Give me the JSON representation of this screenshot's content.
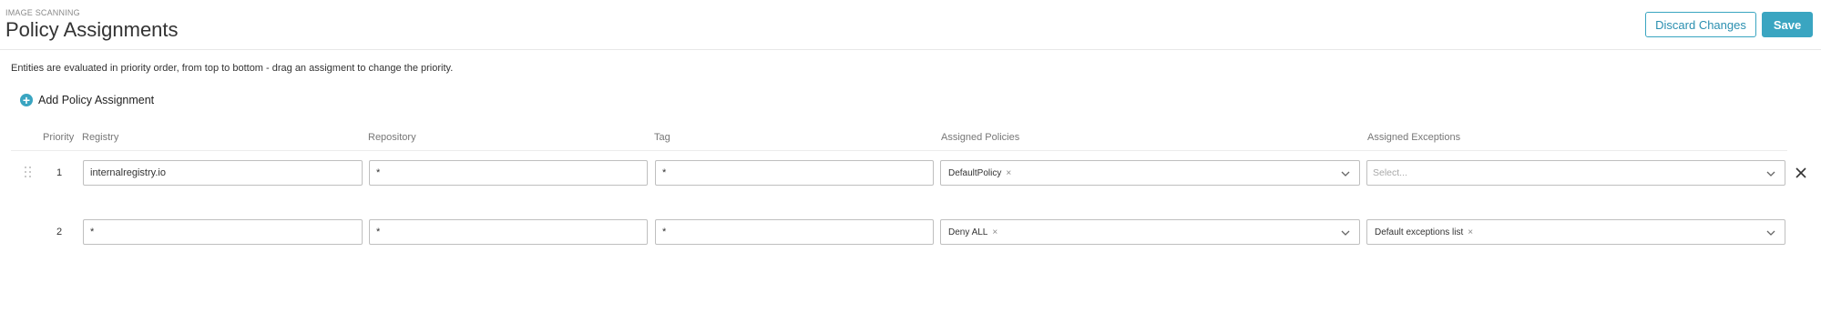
{
  "header": {
    "overline": "IMAGE SCANNING",
    "title": "Policy Assignments",
    "discard_label": "Discard Changes",
    "save_label": "Save"
  },
  "info_text": "Entities are evaluated in priority order, from top to bottom - drag an assigment to change the priority.",
  "add_label": "Add Policy Assignment",
  "columns": {
    "priority": "Priority",
    "registry": "Registry",
    "repository": "Repository",
    "tag": "Tag",
    "policies": "Assigned Policies",
    "exceptions": "Assigned Exceptions"
  },
  "rows": [
    {
      "priority": "1",
      "registry": "internalregistry.io",
      "repository": "*",
      "tag": "*",
      "policies": [
        "DefaultPolicy"
      ],
      "exceptions": [],
      "exceptions_placeholder": "Select...",
      "removable": true
    },
    {
      "priority": "2",
      "registry": "*",
      "repository": "*",
      "tag": "*",
      "policies": [
        "Deny ALL"
      ],
      "exceptions": [
        "Default exceptions list"
      ]
    }
  ],
  "icons": {
    "add": "plus-circle-icon",
    "drag": "drag-handle-icon",
    "chevron": "chevron-down-icon",
    "remove": "close-icon",
    "chip_remove": "x-icon"
  },
  "colors": {
    "accent": "#3aa5c1",
    "border": "#bfbfbf",
    "muted_text": "#777777"
  }
}
